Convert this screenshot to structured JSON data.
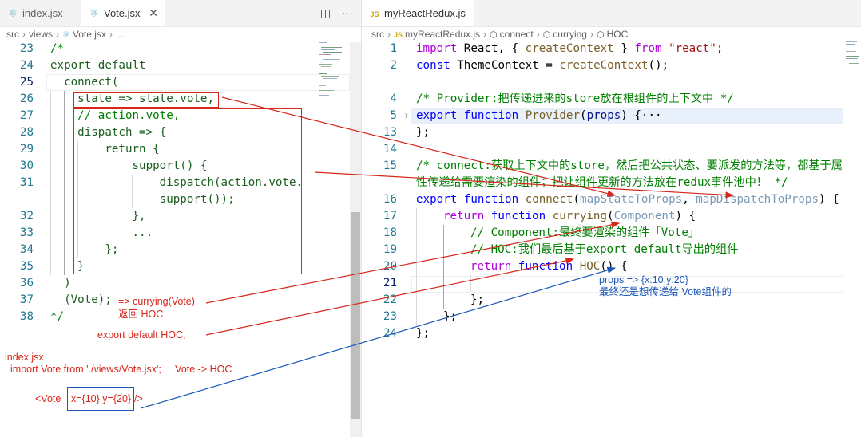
{
  "left_editor": {
    "tabs": [
      {
        "label": "index.jsx",
        "icon": "react-icon",
        "active": false
      },
      {
        "label": "Vote.jsx",
        "icon": "react-icon",
        "active": true,
        "close": "✕"
      }
    ],
    "actions": {
      "split": "◫",
      "more": "···"
    },
    "breadcrumb": [
      "src",
      "views",
      "Vote.jsx",
      "..."
    ],
    "lines": [
      {
        "n": "23",
        "code": "/*"
      },
      {
        "n": "24",
        "code": "export default"
      },
      {
        "n": "25",
        "code": "  connect("
      },
      {
        "n": "26",
        "code": "    state => state.vote,"
      },
      {
        "n": "27",
        "code": "    // action.vote,"
      },
      {
        "n": "28",
        "code": "    dispatch => {"
      },
      {
        "n": "29",
        "code": "        return {"
      },
      {
        "n": "30",
        "code": "            support() {"
      },
      {
        "n": "31",
        "code": "                dispatch(action.vote."
      },
      {
        "n": "",
        "code": "                support());"
      },
      {
        "n": "32",
        "code": "            },"
      },
      {
        "n": "33",
        "code": "            ..."
      },
      {
        "n": "34",
        "code": "        };"
      },
      {
        "n": "35",
        "code": "    }"
      },
      {
        "n": "36",
        "code": "  )"
      },
      {
        "n": "37",
        "code": "  (Vote);"
      },
      {
        "n": "38",
        "code": "*/"
      }
    ]
  },
  "right_editor": {
    "tabs": [
      {
        "label": "myReactRedux.js",
        "icon": "js-icon",
        "badge": "JS",
        "active": true
      }
    ],
    "breadcrumb": [
      "src",
      "myReactRedux.js",
      "connect",
      "currying",
      "HOC"
    ],
    "breadcrumb_js_badge": "JS",
    "fold_marker": "›",
    "lines": {
      "l1": {
        "n": "1",
        "k1": "import",
        "t1": " React, { ",
        "f1": "createContext",
        "t2": " } ",
        "k2": "from",
        "t3": " ",
        "s1": "\"react\"",
        "t4": ";"
      },
      "l2": {
        "n": "2",
        "k1": "const",
        "t1": " ThemeContext = ",
        "f1": "createContext",
        "t2": "();"
      },
      "l4": {
        "n": "4",
        "c": "/* Provider:把传递进来的store放在根组件的上下文中 */"
      },
      "l5": {
        "n": "5",
        "k1": "export",
        "t1": " ",
        "k2": "function",
        "t2": " ",
        "f1": "Provider",
        "t3": "(",
        "v1": "props",
        "t4": ") {",
        "e": "···"
      },
      "l13": {
        "n": "13",
        "t1": "};"
      },
      "l14": {
        "n": "14"
      },
      "l15": {
        "n": "15",
        "c": "/* connect:获取上下文中的store，然后把公共状态、要派发的方法等，都基于属",
        "c2": "性传递给需要渲染的组件；把让组件更新的方法放在redux事件池中！ */"
      },
      "l16": {
        "n": "16",
        "k1": "export",
        "t1": " ",
        "k2": "function",
        "t2": " ",
        "f1": "connect",
        "t3": "(",
        "d1": "mapStateToProps",
        "t4": ", ",
        "d2": "mapDispatchToProps",
        "t5": ") {"
      },
      "l17": {
        "n": "17",
        "k1": "return",
        "t1": " ",
        "k2": "function",
        "t2": " ",
        "f1": "currying",
        "t3": "(",
        "d1": "Component",
        "t4": ") {"
      },
      "l18": {
        "n": "18",
        "c": "// Component:最终要渲染的组件「Vote」"
      },
      "l19": {
        "n": "19",
        "c": "// HOC:我们最后基于export default导出的组件"
      },
      "l20": {
        "n": "20",
        "k1": "return",
        "t1": " ",
        "k2": "function",
        "t2": " ",
        "f1": "HOC",
        "t3": "() {"
      },
      "l21": {
        "n": "21"
      },
      "l22": {
        "n": "22",
        "t1": "};"
      },
      "l23": {
        "n": "23",
        "t1": "};"
      },
      "l24": {
        "n": "24",
        "t1": "};"
      }
    }
  },
  "annotations": {
    "curry": "=> currying(Vote)",
    "return_hoc": "返回 HOC",
    "export_hoc": "export default HOC;",
    "index_file": "index.jsx",
    "import_line": "  import Vote from './views/Vote.jsx';     Vote -> HOC",
    "vote_open": "<Vote",
    "vote_props": "x={10} y={20}",
    "vote_close": "/>",
    "props_line": "props => {x:10,y:20}",
    "props_desc": "最终还是想传递给 Vote组件的"
  },
  "colors": {
    "annotation_red": "#d7261b",
    "annotation_blue": "#1a57b8",
    "keyword": "#0000ff",
    "control": "#af00db",
    "function": "#795e26",
    "comment": "#008000",
    "string": "#a31515",
    "line_number": "#237893"
  }
}
